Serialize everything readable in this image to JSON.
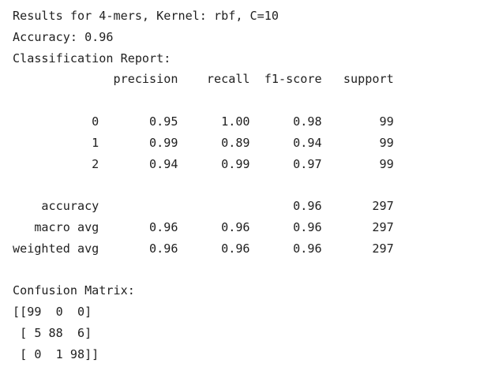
{
  "output": {
    "lines": [
      "Results for 4-mers, Kernel: rbf, C=10",
      "Accuracy: 0.96",
      "Classification Report:",
      "              precision    recall  f1-score   support",
      "",
      "           0       0.95      1.00      0.98        99",
      "           1       0.99      0.89      0.94        99",
      "           2       0.94      0.99      0.97        99",
      "",
      "    accuracy                           0.96       297",
      "   macro avg       0.96      0.96      0.96       297",
      "weighted avg       0.96      0.96      0.96       297",
      "",
      "Confusion Matrix:",
      "[[99  0  0]",
      " [ 5 88  6]",
      " [ 0  1 98]]"
    ]
  }
}
